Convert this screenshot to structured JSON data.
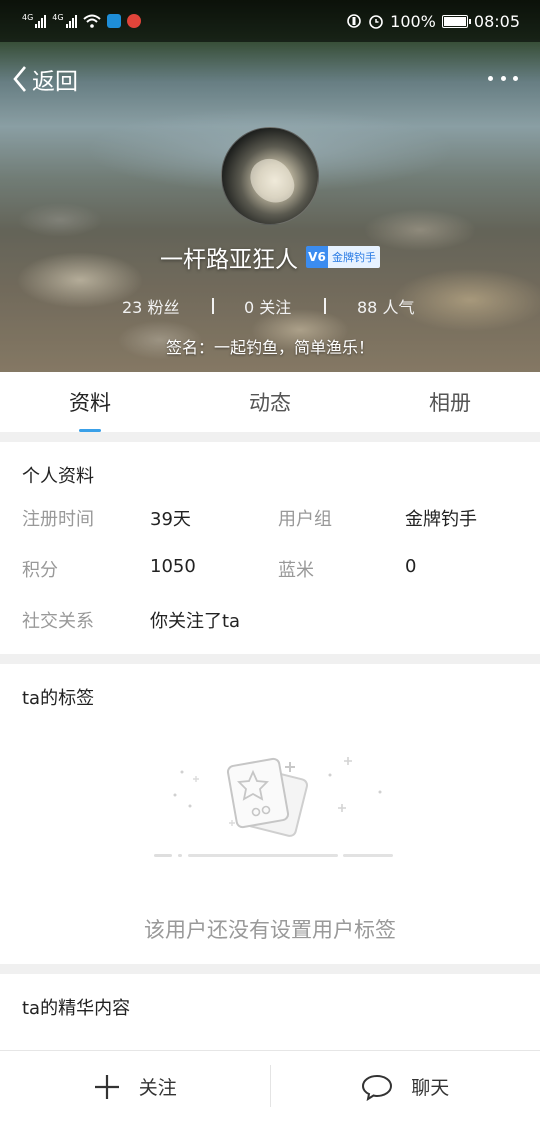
{
  "status_bar": {
    "signal_1_label": "4G",
    "signal_2_label": "4G",
    "battery_text": "100%",
    "time": "08:05",
    "battery_level": 1.0
  },
  "nav": {
    "back_label": "返回",
    "back_icon": "chevron-left-icon",
    "more_icon": "more-dots-icon"
  },
  "profile_header": {
    "nickname": "一杆路亚狂人",
    "badge_icon_text": "V6",
    "badge_label": "金牌钓手",
    "fans": "23 粉丝",
    "following": "0 关注",
    "popularity": "88 人气",
    "signature": "签名：一起钓鱼，简单渔乐！"
  },
  "tabs": [
    {
      "label": "资料",
      "active": true
    },
    {
      "label": "动态",
      "active": false
    },
    {
      "label": "相册",
      "active": false
    }
  ],
  "personal_info": {
    "title": "个人资料",
    "register_label": "注册时间",
    "register_value": "39天",
    "group_label": "用户组",
    "group_value": "金牌钓手",
    "points_label": "积分",
    "points_value": "1050",
    "lanmi_label": "蓝米",
    "lanmi_value": "0",
    "social_label": "社交关系",
    "social_value": "你关注了ta"
  },
  "tags_section": {
    "title": "ta的标签",
    "empty_text": "该用户还没有设置用户标签"
  },
  "essence_section": {
    "title": "ta的精华内容"
  },
  "bottom_bar": {
    "follow_label": "关注",
    "chat_label": "聊天"
  },
  "colors": {
    "accent": "#3aa0e8",
    "badge_blue": "#3b8cf0"
  }
}
